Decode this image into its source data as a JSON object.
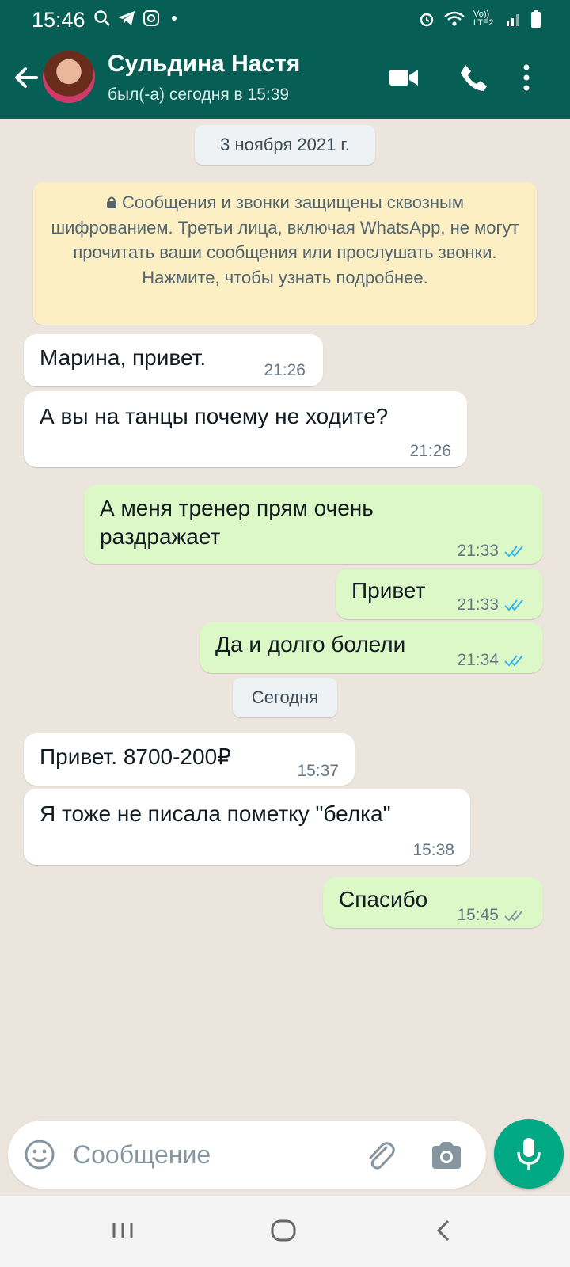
{
  "status_bar": {
    "time": "15:46",
    "left_icons": [
      "search-icon",
      "telegram-icon",
      "instagram-icon",
      "dot-icon"
    ],
    "right_icons": [
      "alarm-icon",
      "wifi-icon",
      "volte-icon",
      "signal-icon",
      "battery-icon"
    ],
    "network_label": "Vo)) LTE2"
  },
  "header": {
    "contact_name": "Сульдина Настя",
    "last_seen": "был(-а) сегодня в 15:39",
    "icons": [
      "back-arrow-icon",
      "avatar",
      "video-call-icon",
      "phone-icon",
      "more-vert-icon"
    ]
  },
  "chat": {
    "date_separators": [
      "3 ноября 2021 г.",
      "Сегодня"
    ],
    "encryption_notice": "Сообщения и звонки защищены сквозным шифрованием. Третьи лица, включая WhatsApp, не могут прочитать ваши сообщения или прослушать звонки. Нажмите, чтобы узнать подробнее.",
    "messages": [
      {
        "direction": "incoming",
        "text": "Марина, привет.",
        "time": "21:26"
      },
      {
        "direction": "incoming",
        "text": "А вы на танцы почему не ходите?",
        "time": "21:26"
      },
      {
        "direction": "outgoing",
        "text_lines": [
          "А меня тренер прям очень",
          "раздражает"
        ],
        "time": "21:33",
        "status": "read"
      },
      {
        "direction": "outgoing",
        "text": "Привет",
        "time": "21:33",
        "status": "read"
      },
      {
        "direction": "outgoing",
        "text": "Да и долго болели",
        "time": "21:34",
        "status": "read"
      },
      {
        "direction": "incoming",
        "text": "Привет. 8700-200₽",
        "time": "15:37"
      },
      {
        "direction": "incoming",
        "text": "Я тоже не писала пометку \"белка\"",
        "time": "15:38"
      },
      {
        "direction": "outgoing",
        "text": "Спасибо",
        "time": "15:45",
        "status": "delivered"
      }
    ]
  },
  "composer": {
    "placeholder": "Сообщение",
    "icons": [
      "emoji-icon",
      "attach-icon",
      "camera-icon",
      "mic-icon"
    ]
  },
  "colors": {
    "header": "#075e54",
    "chat_background": "#ece5dd",
    "outgoing_bubble": "#dcf8c6",
    "incoming_bubble": "#ffffff",
    "notice": "#fcefc4",
    "read_tick": "#34b7f1",
    "mic_button": "#00a884"
  }
}
